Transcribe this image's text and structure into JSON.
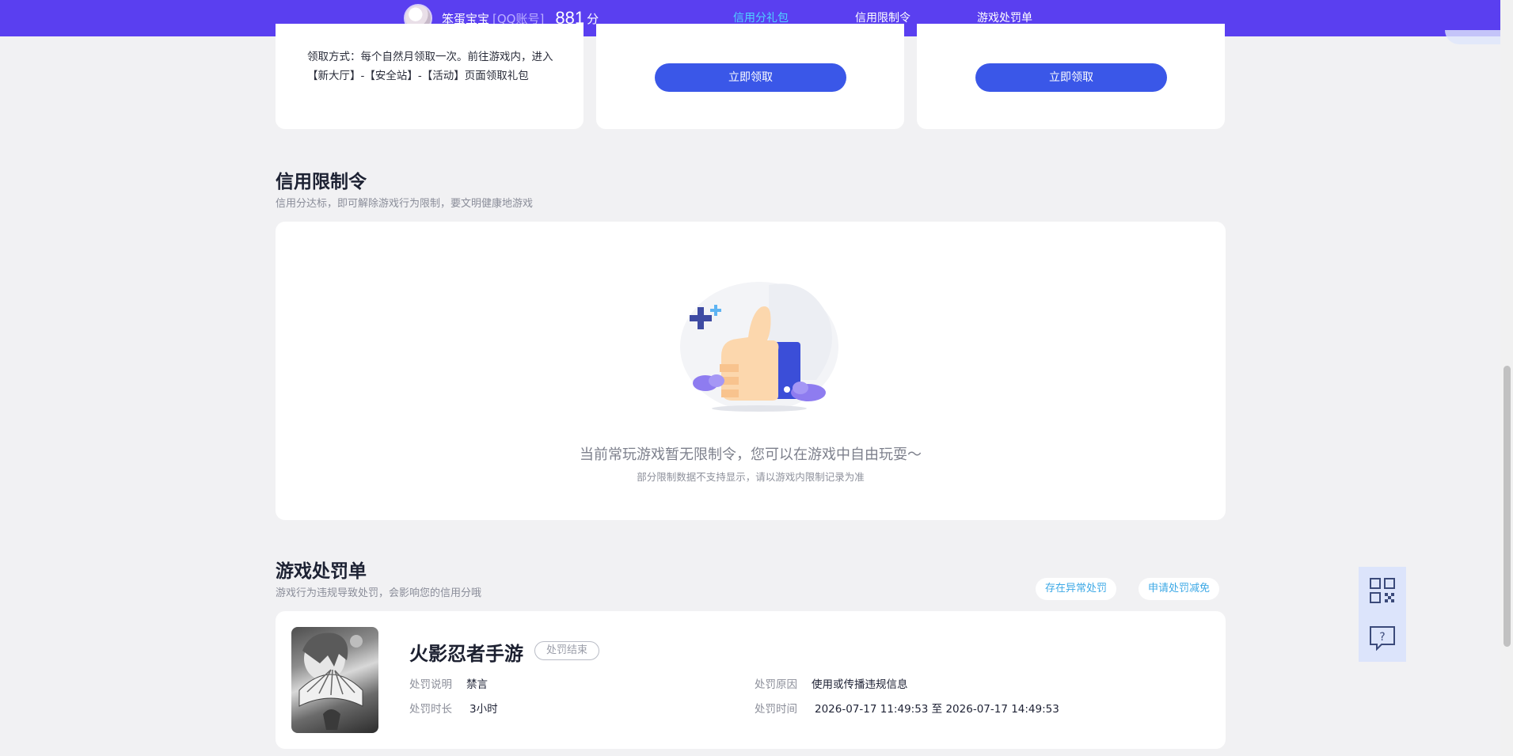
{
  "header": {
    "user_name": "笨蛋宝宝",
    "account_type": "[QQ账号]",
    "score": "881",
    "score_unit": "分",
    "tabs": [
      {
        "label": "信用分礼包",
        "active": true
      },
      {
        "label": "信用限制令",
        "active": false
      },
      {
        "label": "游戏处罚单",
        "active": false
      }
    ],
    "brand_color": "#5a3ff0",
    "active_color": "#4fd2ff"
  },
  "gift_cards": {
    "desc": "领取方式：每个自然月领取一次。前往游戏内，进入【新大厅】-【安全站】-【活动】页面领取礼包",
    "claim_label_1": "立即领取",
    "claim_label_2": "立即领取"
  },
  "restriction": {
    "title": "信用限制令",
    "subtitle": "信用分达标，即可解除游戏行为限制，要文明健康地游戏",
    "empty_text": "当前常玩游戏暂无限制令，您可以在游戏中自由玩耍～",
    "empty_note": "部分限制数据不支持显示，请以游戏内限制记录为准"
  },
  "penalty": {
    "title": "游戏处罚单",
    "subtitle": "游戏行为违规导致处罚，会影响您的信用分哦",
    "abnormal_label": "存在异常处罚",
    "appeal_label": "申请处罚减免",
    "item": {
      "game": "火影忍者手游",
      "status": "处罚结束",
      "desc_label": "处罚说明",
      "desc_value": "禁言",
      "duration_label": "处罚时长",
      "duration_value": "3小时",
      "reason_label": "处罚原因",
      "reason_value": "使用或传播违规信息",
      "time_label": "处罚时间",
      "time_value": "2026-07-17 11:49:53 至 2026-07-17 14:49:53"
    }
  },
  "floating": {
    "qr_icon": "qr-code-icon",
    "help_icon": "help-chat-icon"
  }
}
